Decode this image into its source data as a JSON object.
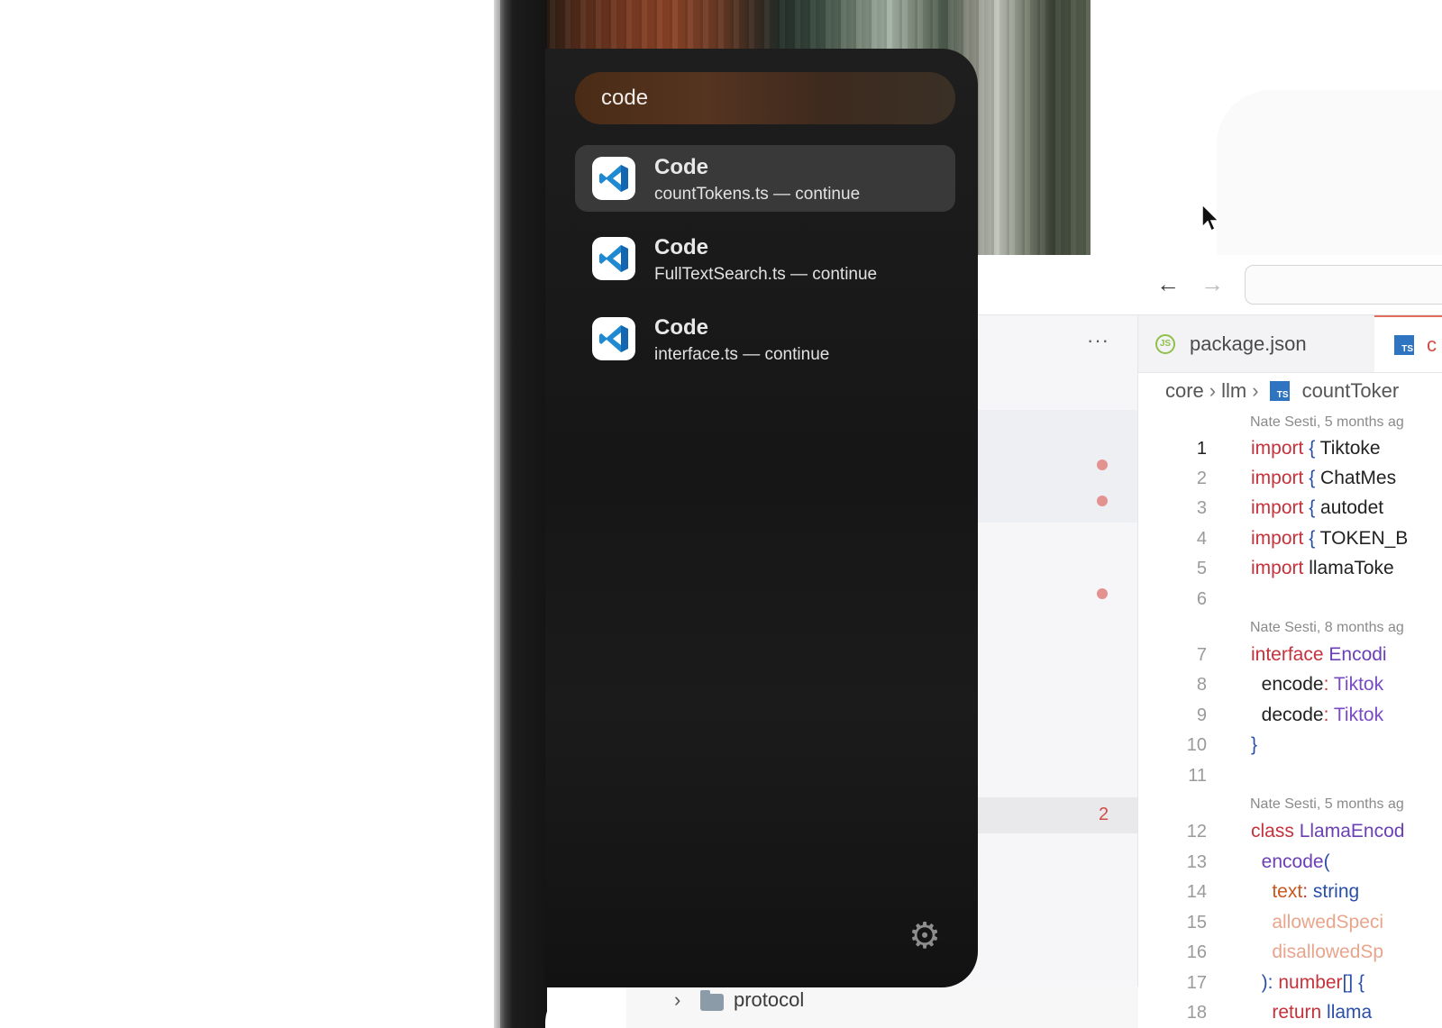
{
  "launcher": {
    "search_query": "code",
    "results": [
      {
        "title": "Code",
        "subtitle": "countTokens.ts — continue",
        "selected": true
      },
      {
        "title": "Code",
        "subtitle": "FullTextSearch.ts — continue",
        "selected": false
      },
      {
        "title": "Code",
        "subtitle": "interface.ts — continue",
        "selected": false
      }
    ],
    "settings_icon": "gear-icon"
  },
  "browser": {
    "back_icon": "←",
    "forward_icon": "→"
  },
  "editor": {
    "more_label": "···",
    "badge_count": "2",
    "tabs": [
      {
        "label": "package.json",
        "icon": "js-file-icon"
      },
      {
        "label": "c",
        "icon": "ts-file-icon"
      }
    ],
    "breadcrumb": [
      "core",
      "llm",
      "countToker"
    ],
    "tree_folder": "protocol",
    "blame": [
      "Nate Sesti, 5 months ag",
      "Nate Sesti, 8 months ag",
      "Nate Sesti, 5 months ag"
    ],
    "line_numbers": [
      "1",
      "2",
      "3",
      "4",
      "5",
      "6",
      "7",
      "8",
      "9",
      "10",
      "11",
      "12",
      "13",
      "14",
      "15",
      "16",
      "17",
      "18"
    ]
  },
  "colors": {
    "launcher_bg": "#1b1b1b",
    "selected_row": "#393939",
    "vscode_blue": "#1f8ad2",
    "accent_red": "#d24b46"
  }
}
